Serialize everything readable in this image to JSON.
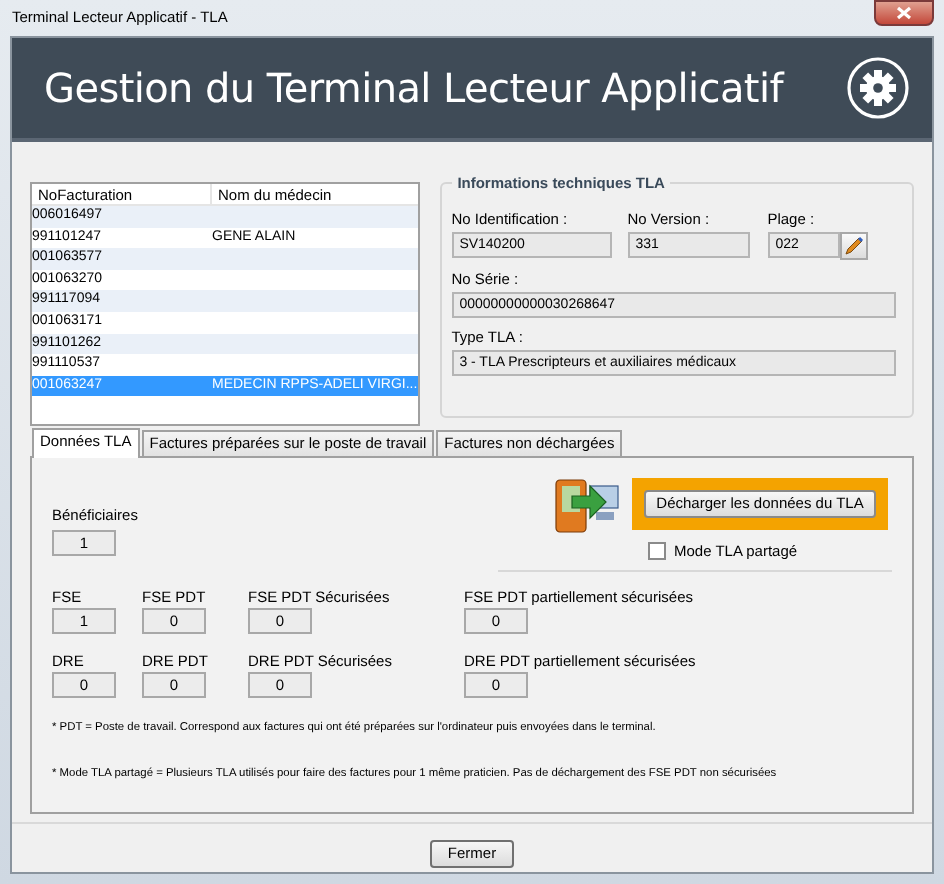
{
  "window": {
    "title": "Terminal Lecteur Applicatif - TLA"
  },
  "header": {
    "title": "Gestion du Terminal Lecteur Applicatif"
  },
  "invoices": {
    "columns": [
      "NoFacturation",
      "Nom du médecin"
    ],
    "rows": [
      {
        "number": "006016497",
        "doctor": "",
        "selected": false
      },
      {
        "number": "991101247",
        "doctor": "GENE ALAIN",
        "selected": false
      },
      {
        "number": "001063577",
        "doctor": "",
        "selected": false
      },
      {
        "number": "001063270",
        "doctor": "",
        "selected": false
      },
      {
        "number": "991117094",
        "doctor": "",
        "selected": false
      },
      {
        "number": "001063171",
        "doctor": "",
        "selected": false
      },
      {
        "number": "991101262",
        "doctor": "",
        "selected": false
      },
      {
        "number": "991110537",
        "doctor": "",
        "selected": false
      },
      {
        "number": "001063247",
        "doctor": "MEDECIN RPPS-ADELI VIRGI...",
        "selected": true
      }
    ]
  },
  "tech_info": {
    "title": "Informations techniques TLA",
    "identification": {
      "label": "No Identification :",
      "value": "SV140200"
    },
    "version": {
      "label": "No Version :",
      "value": "331"
    },
    "range": {
      "label": "Plage :",
      "value": "022"
    },
    "serial": {
      "label": "No Série :",
      "value": "00000000000030268647"
    },
    "type": {
      "label": "Type TLA :",
      "value": "3 - TLA Prescripteurs et auxiliaires médicaux"
    }
  },
  "tabs": [
    {
      "label": "Données TLA",
      "selected": true
    },
    {
      "label": "Factures préparées sur le poste de travail",
      "selected": false
    },
    {
      "label": "Factures non déchargées",
      "selected": false
    }
  ],
  "download_button": {
    "label": "Décharger les données du TLA",
    "highlighted": true
  },
  "shared_mode": {
    "label": "Mode TLA partagé",
    "checked": false
  },
  "beneficiaries": {
    "label": "Bénéficiaires",
    "value": "1"
  },
  "counter_rows": [
    [
      {
        "label": "FSE",
        "value": "1"
      },
      {
        "label": "FSE PDT",
        "value": "0"
      },
      {
        "label": "FSE PDT Sécurisées",
        "value": "0"
      },
      {
        "label": "FSE PDT partiellement sécurisées",
        "value": "0"
      }
    ],
    [
      {
        "label": "DRE",
        "value": "0"
      },
      {
        "label": "DRE PDT",
        "value": "0"
      },
      {
        "label": "DRE PDT Sécurisées",
        "value": "0"
      },
      {
        "label": "DRE PDT partiellement sécurisées",
        "value": "0"
      }
    ]
  ],
  "footnotes": [
    "* PDT = Poste de travail. Correspond aux factures qui ont été préparées sur l'ordinateur puis envoyées dans le terminal.",
    "* Mode TLA partagé = Plusieurs TLA utilisés pour faire des factures pour 1 même praticien. Pas de déchargement des FSE PDT non sécurisées"
  ],
  "close_button": {
    "label": "Fermer"
  }
}
